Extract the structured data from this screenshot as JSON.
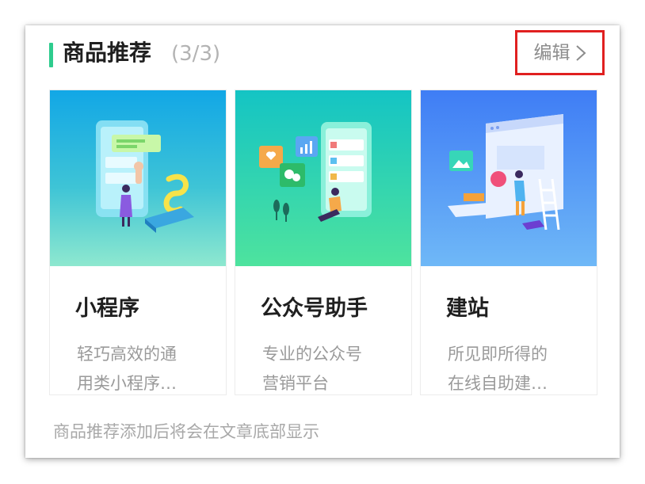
{
  "section": {
    "title": "商品推荐",
    "count": "(3/3)",
    "edit_label": "编辑",
    "accent_color": "#2ecc8e",
    "highlight_color": "#e02020"
  },
  "products": [
    {
      "name": "小程序",
      "desc_line1": "轻巧高效的通",
      "desc_line2": "用类小程序…",
      "icon": "mini-program-illustration"
    },
    {
      "name": "公众号助手",
      "desc_line1": "专业的公众号",
      "desc_line2": "营销平台",
      "icon": "official-account-illustration"
    },
    {
      "name": "建站",
      "desc_line1": "所见即所得的",
      "desc_line2": "在线自助建…",
      "icon": "website-builder-illustration"
    }
  ],
  "footer_note": "商品推荐添加后将会在文章底部显示"
}
